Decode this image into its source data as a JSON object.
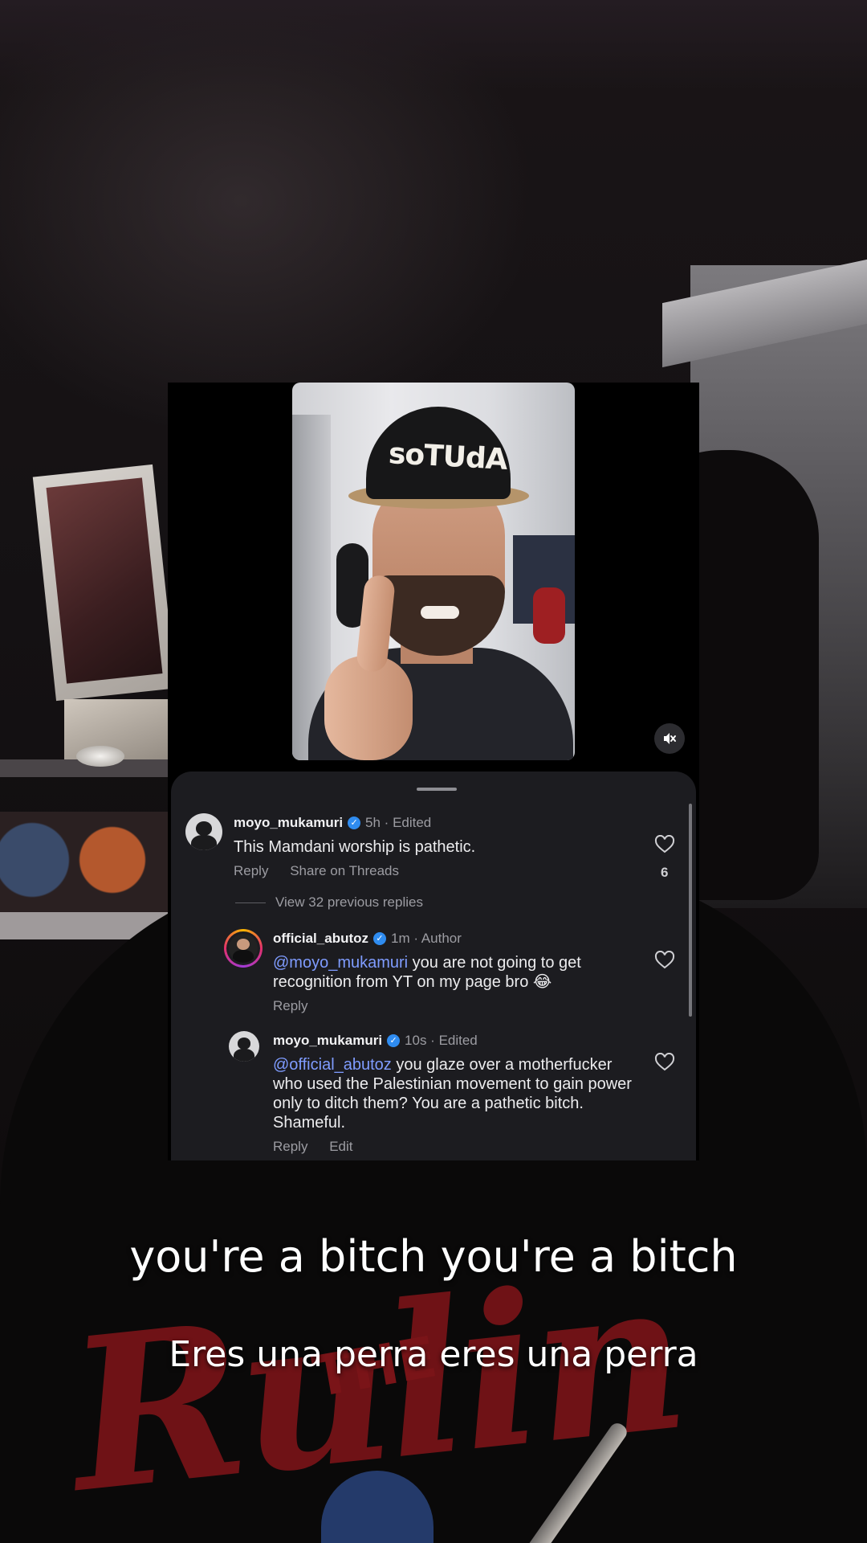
{
  "embed": {
    "video": {
      "cap_text": "soTUdA",
      "mute_icon": "speaker-muted-icon"
    },
    "comments": [
      {
        "username": "moyo_mukamuri",
        "verified": true,
        "meta": "5h · Edited",
        "text": "This Mamdani worship is pathetic.",
        "actions": [
          "Reply",
          "Share on Threads"
        ],
        "likes": "6"
      },
      {
        "username": "official_abutoz",
        "verified": true,
        "meta": "1m · Author",
        "mention": "@moyo_mukamuri",
        "text": " you are not going to get recognition from YT on my page bro 😂",
        "actions": [
          "Reply"
        ]
      },
      {
        "username": "moyo_mukamuri",
        "verified": true,
        "meta": "10s · Edited",
        "mention": "@official_abutoz",
        "text": " you glaze over a motherfucker who used the Palestinian movement to gain power only to ditch them? You are a pathetic bitch. Shameful.",
        "actions": [
          "Reply",
          "Edit"
        ]
      }
    ],
    "view_replies": "View 32 previous replies"
  },
  "background": {
    "shirt_text": "Rulin",
    "shirt_small": "THE"
  },
  "captions": {
    "english": "you're a bitch you're a bitch",
    "spanish": "Eres una perra eres una perra"
  },
  "colors": {
    "mention": "#7f9cff",
    "verified": "#2f8cf0",
    "sheet_bg": "#1c1c20"
  }
}
